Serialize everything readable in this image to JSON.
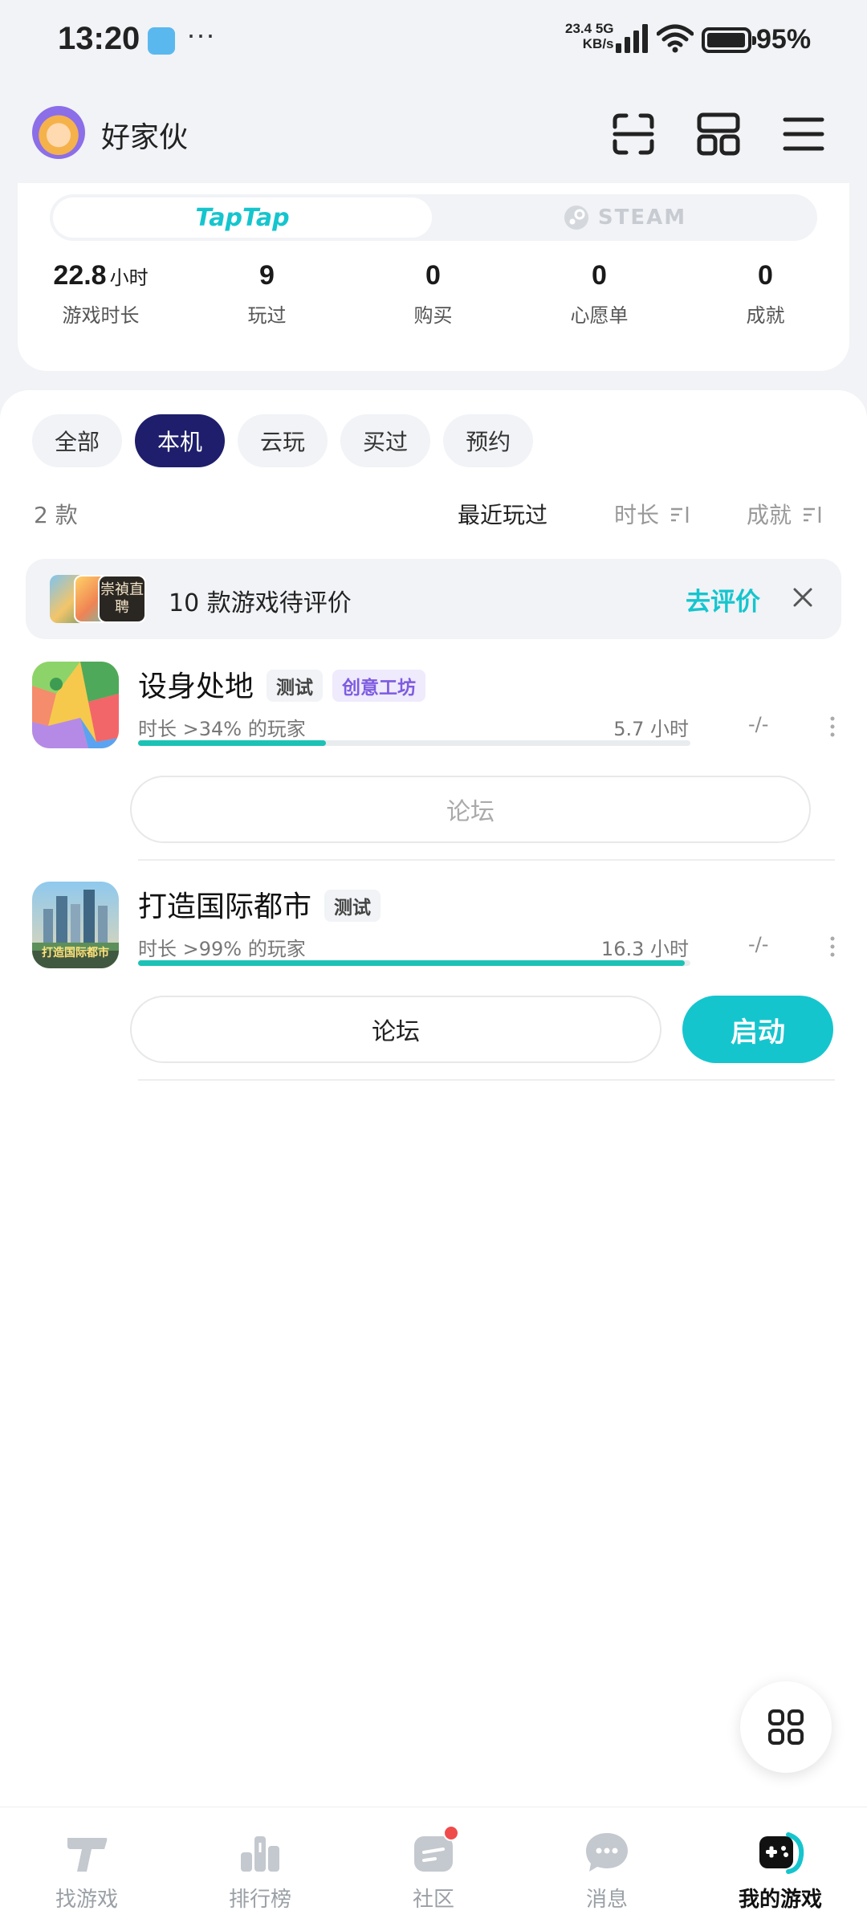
{
  "status_bar": {
    "time": "13:20",
    "dots": "···",
    "net_speed": "23.4",
    "net_unit": "KB/s",
    "net_type": "5G",
    "battery": "95%"
  },
  "header": {
    "username": "好家伙"
  },
  "platform_tabs": {
    "taptap": "TapTap",
    "steam": "STEAM"
  },
  "stats": [
    {
      "value": "22.8",
      "unit": "小时",
      "label": "游戏时长"
    },
    {
      "value": "9",
      "unit": "",
      "label": "玩过"
    },
    {
      "value": "0",
      "unit": "",
      "label": "购买"
    },
    {
      "value": "0",
      "unit": "",
      "label": "心愿单"
    },
    {
      "value": "0",
      "unit": "",
      "label": "成就"
    }
  ],
  "filters": [
    "全部",
    "本机",
    "云玩",
    "买过",
    "预约"
  ],
  "active_filter": "本机",
  "list": {
    "count": "2 款",
    "sort_recent": "最近玩过",
    "sort_duration": "时长",
    "sort_achievement": "成就"
  },
  "review_banner": {
    "thumb_text": "崇禎直聘",
    "text": "10 款游戏待评价",
    "action": "去评价"
  },
  "games": [
    {
      "title": "设身处地",
      "tags": [
        "测试",
        "创意工坊"
      ],
      "hint": "时长 >34% 的玩家",
      "hours": "5.7 小时",
      "progress": 0.34,
      "achievement": "-/-",
      "forum": "论坛"
    },
    {
      "title": "打造国际都市",
      "tags": [
        "测试"
      ],
      "icon_text": "打造国际都市",
      "hint": "时长 >99% 的玩家",
      "hours": "16.3 小时",
      "progress": 0.99,
      "achievement": "-/-",
      "forum": "论坛",
      "launch": "启动"
    }
  ],
  "bottom_nav": [
    "找游戏",
    "排行榜",
    "社区",
    "消息",
    "我的游戏"
  ],
  "colors": {
    "accent": "#15c5ce",
    "active_chip": "#1e1e6c",
    "progress": "#1cc2b5",
    "badge": "#f04b4b"
  }
}
